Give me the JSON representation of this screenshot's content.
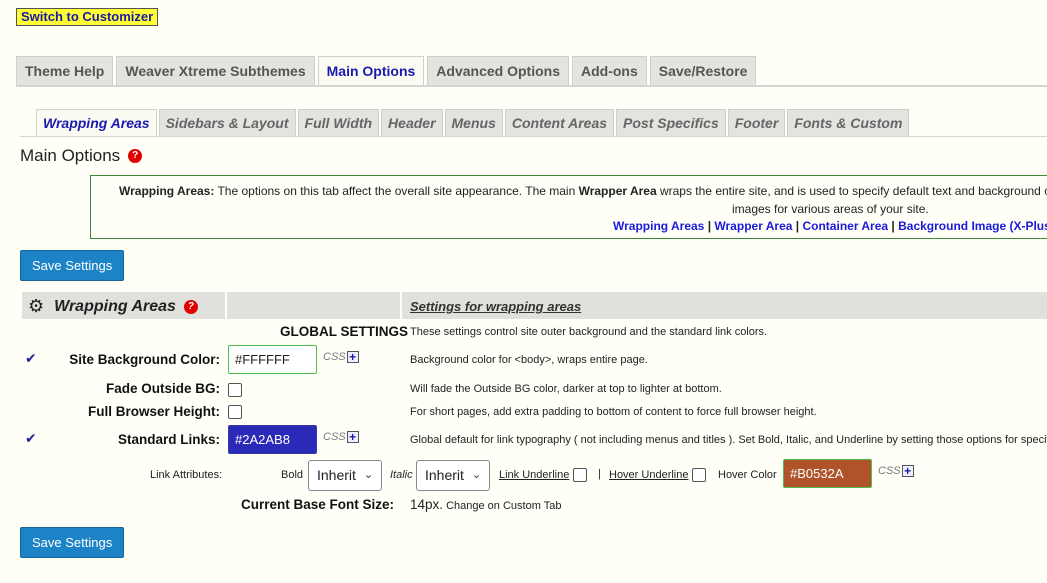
{
  "switch_label": "Switch to Customizer",
  "main_tabs": [
    "Theme Help",
    "Weaver Xtreme Subthemes",
    "Main Options",
    "Advanced Options",
    "Add-ons",
    "Save/Restore"
  ],
  "sub_tabs": [
    "Wrapping Areas",
    "Sidebars & Layout",
    "Full Width",
    "Header",
    "Menus",
    "Content Areas",
    "Post Specifics",
    "Footer",
    "Fonts & Custom"
  ],
  "page_title": "Main Options",
  "help_glyph": "?",
  "info": {
    "lead_label": "Wrapping Areas:",
    "text1": " The options on this tab affect the overall site appearance. The main ",
    "wrapper_label": "Wrapper Area",
    "text2": " wraps the entire site, and is used to specify default text and background colors,",
    "text3": "images for various areas of your site.",
    "links": [
      "Wrapping Areas",
      "Wrapper Area",
      "Container Area",
      "Background Image (X-Plus)"
    ],
    "sep": "|"
  },
  "save_label": "Save Settings",
  "section": {
    "title": "Wrapping Areas",
    "settings_heading": "Settings for wrapping areas",
    "global_heading": "GLOBAL SETTINGS",
    "global_desc": "These settings control site outer background and the standard link colors."
  },
  "rows": {
    "site_bg": {
      "label": "Site Background Color:",
      "value": "#FFFFFF",
      "desc": "Background color for <body>, wraps entire page."
    },
    "fade": {
      "label": "Fade Outside BG:",
      "desc": "Will fade the Outside BG color, darker at top to lighter at bottom."
    },
    "full_height": {
      "label": "Full Browser Height:",
      "desc": "For short pages, add extra padding to bottom of content to force full browser height."
    },
    "std_links": {
      "label": "Standard Links:",
      "value": "#2A2AB8",
      "desc": "Global default for link typography ( not including menus and titles ). Set Bold, Italic, and Underline by setting those options for specifi"
    },
    "link_attrs": {
      "label": "Link Attributes:",
      "bold_label": "Bold",
      "bold_value": "Inherit",
      "italic_label": "Italic",
      "italic_value": "Inherit",
      "underline_label": "Link Underline",
      "pipe": "|",
      "hover_underline_label": "Hover Underline",
      "hover_color_label": "Hover Color",
      "hover_color_value": "#B0532A"
    },
    "base_font": {
      "label": "Current Base Font Size:",
      "value": "14px.",
      "note": " Change on Custom Tab"
    }
  },
  "css_label": "CSS",
  "plus_glyph": "+",
  "colors": {
    "accent": "#1c83c6",
    "link_color": "#2A2AB8",
    "hover_color": "#B0532A",
    "switch_bg": "#ffff33"
  }
}
